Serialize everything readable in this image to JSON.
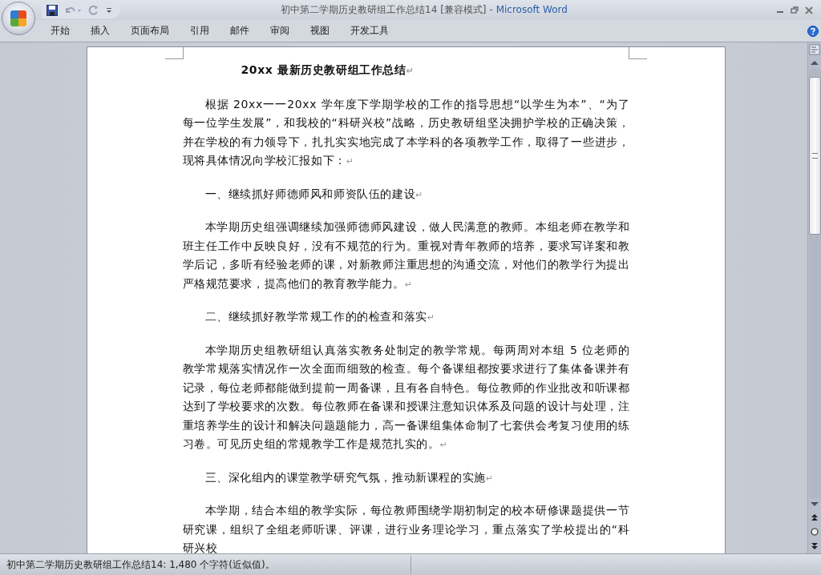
{
  "window": {
    "title_document": "初中第二学期历史教研组工作总结14 [兼容模式]",
    "title_app": "- Microsoft Word"
  },
  "ribbon_tabs": [
    {
      "label": "开始"
    },
    {
      "label": "插入"
    },
    {
      "label": "页面布局"
    },
    {
      "label": "引用"
    },
    {
      "label": "邮件"
    },
    {
      "label": "审阅"
    },
    {
      "label": "视图"
    },
    {
      "label": "开发工具"
    }
  ],
  "document": {
    "paragraphs": [
      {
        "kind": "title",
        "text": "20xx 最新历史教研组工作总结",
        "end_mark": "↵"
      },
      {
        "kind": "body",
        "text": "根据 20xx一一20xx 学年度下学期学校的工作的指导思想“以学生为本”、“为了每一位学生发展”，和我校的“科研兴校”战略，历史教研组坚决拥护学校的正确决策，并在学校的有力领导下，扎扎实实地完成了本学科的各项教学工作，取得了一些进步，现将具体情况向学校汇报如下：",
        "end_mark": "↵"
      },
      {
        "kind": "heading",
        "text": "一、继续抓好师德师风和师资队伍的建设",
        "end_mark": "↵"
      },
      {
        "kind": "body",
        "text": "本学期历史组强调继续加强师德师风建设，做人民满意的教师。本组老师在教学和班主任工作中反映良好，没有不规范的行为。重视对青年教师的培养，要求写详案和教学后记，多听有经验老师的课，对新教师注重思想的沟通交流，对他们的教学行为提出严格规范要求，提高他们的教育教学能力。",
        "end_mark": "↵"
      },
      {
        "kind": "heading",
        "text": "二、继续抓好教学常规工作的的检查和落实",
        "end_mark": "↵"
      },
      {
        "kind": "body",
        "text": "本学期历史组教研组认真落实教务处制定的教学常规。每两周对本组 5 位老师的教学常规落实情况作一次全面而细致的检查。每个备课组都按要求进行了集体备课并有记录，每位老师都能做到提前一周备课，且有各自特色。每位教师的作业批改和听课都达到了学校要求的次数。每位教师在备课和授课注意知识体系及问题的设计与处理，注重培养学生的设计和解决问题题能力，高一备课组集体命制了七套供会考复习使用的练习卷。可见历史组的常规教学工作是规范扎实的。",
        "end_mark": "↵"
      },
      {
        "kind": "heading",
        "text": "三、深化组内的课堂教学研究气氛，推动新课程的实施",
        "end_mark": "↵"
      },
      {
        "kind": "body",
        "text": "本学期，结合本组的教学实际，每位教师围绕学期初制定的校本研修课题提供一节研究课，组织了全组老师听课、评课，进行业务理论学习，重点落实了学校提出的“科研兴校"
      }
    ]
  },
  "status_bar": {
    "text": "初中第二学期历史教研组工作总结14: 1,480 个字符(近似值)。"
  }
}
